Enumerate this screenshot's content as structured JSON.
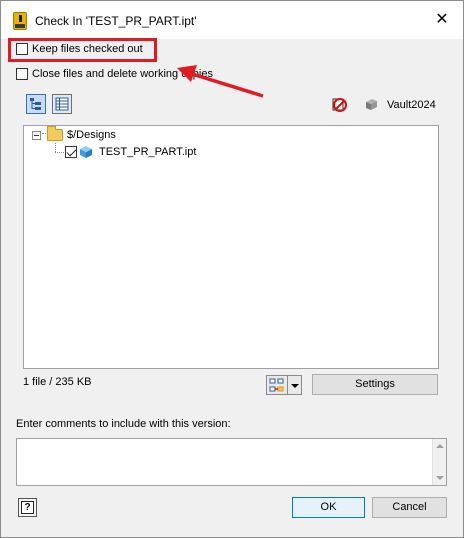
{
  "window": {
    "title": "Check In 'TEST_PR_PART.ipt'"
  },
  "options": {
    "keep_checked_out": {
      "label": "Keep files checked out",
      "checked": false
    },
    "close_and_delete": {
      "label": "Close files and delete working copies",
      "checked": false
    }
  },
  "toolbar": {
    "vault_name": "Vault2024"
  },
  "tree": {
    "root": {
      "label": "$/Designs",
      "expanded": true
    },
    "files": [
      {
        "label": "TEST_PR_PART.ipt",
        "checked": true
      }
    ]
  },
  "status": {
    "summary": "1 file / 235 KB"
  },
  "buttons": {
    "settings": "Settings",
    "ok": "OK",
    "cancel": "Cancel",
    "help": "?"
  },
  "comments": {
    "label": "Enter comments to include with this version:",
    "value": ""
  },
  "annotation": {
    "highlight_color": "#e01b24"
  }
}
